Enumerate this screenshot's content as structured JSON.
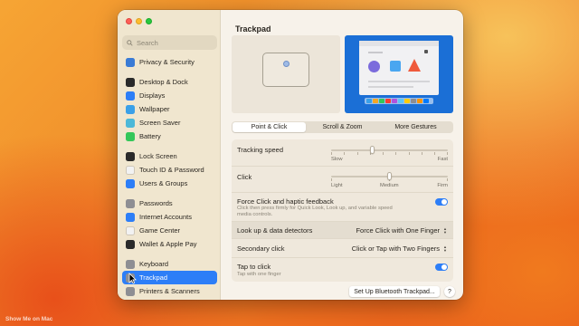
{
  "window": {
    "title": "Trackpad",
    "search_placeholder": "Search"
  },
  "sidebar": {
    "items": [
      {
        "label": "Privacy & Security",
        "icon": "hand-icon",
        "color": "#3a7bd5",
        "group": 1
      },
      {
        "label": "Desktop & Dock",
        "icon": "dock-icon",
        "color": "#2a2a2a",
        "group": 2
      },
      {
        "label": "Displays",
        "icon": "sun-icon",
        "color": "#2d7ef7",
        "group": 2
      },
      {
        "label": "Wallpaper",
        "icon": "wallpaper-icon",
        "color": "#3aa0e8",
        "group": 2
      },
      {
        "label": "Screen Saver",
        "icon": "screensaver-icon",
        "color": "#4cb8d8",
        "group": 2
      },
      {
        "label": "Battery",
        "icon": "battery-icon",
        "color": "#34c759",
        "group": 2
      },
      {
        "label": "Lock Screen",
        "icon": "lock-icon",
        "color": "#2a2a2a",
        "group": 3
      },
      {
        "label": "Touch ID & Password",
        "icon": "fingerprint-icon",
        "color": "#f2f2f2",
        "group": 3
      },
      {
        "label": "Users & Groups",
        "icon": "users-icon",
        "color": "#2d7ef7",
        "group": 3
      },
      {
        "label": "Passwords",
        "icon": "key-icon",
        "color": "#8e8e93",
        "group": 4
      },
      {
        "label": "Internet Accounts",
        "icon": "at-icon",
        "color": "#2d7ef7",
        "group": 4
      },
      {
        "label": "Game Center",
        "icon": "gamecenter-icon",
        "color": "#f2f2f2",
        "group": 4
      },
      {
        "label": "Wallet & Apple Pay",
        "icon": "wallet-icon",
        "color": "#2a2a2a",
        "group": 4
      },
      {
        "label": "Keyboard",
        "icon": "keyboard-icon",
        "color": "#8e8e93",
        "group": 5
      },
      {
        "label": "Trackpad",
        "icon": "trackpad-icon",
        "color": "#8e8e93",
        "group": 5,
        "selected": true
      },
      {
        "label": "Printers & Scanners",
        "icon": "printer-icon",
        "color": "#8e8e93",
        "group": 5
      }
    ]
  },
  "tabs": [
    {
      "label": "Point & Click",
      "active": true
    },
    {
      "label": "Scroll & Zoom",
      "active": false
    },
    {
      "label": "More Gestures",
      "active": false
    }
  ],
  "settings": {
    "tracking_speed": {
      "label": "Tracking speed",
      "min_label": "Slow",
      "max_label": "Fast",
      "value_fraction": 0.35
    },
    "click": {
      "label": "Click",
      "min_label": "Light",
      "mid_label": "Medium",
      "max_label": "Firm",
      "value_fraction": 0.5
    },
    "force_click": {
      "label": "Force Click and haptic feedback",
      "description_line1": "Click then press firmly for Quick Look, Look up, and variable speed",
      "description_line2": "media controls.",
      "enabled": true
    },
    "look_up": {
      "label": "Look up & data detectors",
      "value": "Force Click with One Finger"
    },
    "secondary_click": {
      "label": "Secondary click",
      "value": "Click or Tap with Two Fingers"
    },
    "tap_to_click": {
      "label": "Tap to click",
      "description": "Tap with one finger",
      "enabled": true
    }
  },
  "buttons": {
    "bluetooth_setup": "Set Up Bluetooth Trackpad...",
    "help": "?"
  },
  "wallpaper_caption": "Show Me on Mac",
  "colors": {
    "accent": "#2d7ef7",
    "sidebar_bg": "#f0e6cf",
    "window_bg": "#f7f2ea"
  }
}
